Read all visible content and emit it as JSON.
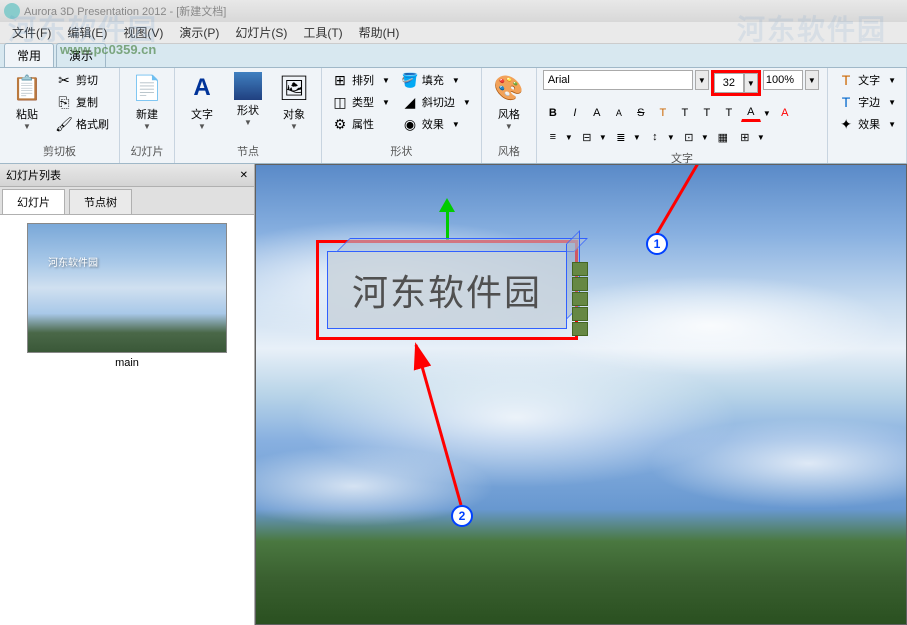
{
  "title": "Aurora 3D Presentation 2012 - [新建文档]",
  "watermark": "河东软件园",
  "watermark_url": "www.pc0359.cn",
  "menu": {
    "file": "文件(F)",
    "edit": "编辑(E)",
    "view": "视图(V)",
    "present": "演示(P)",
    "slide": "幻灯片(S)",
    "tools": "工具(T)",
    "help": "帮助(H)"
  },
  "tabs": {
    "common": "常用",
    "present": "演示"
  },
  "ribbon": {
    "clipboard": {
      "label": "剪切板",
      "paste": "粘贴",
      "cut": "剪切",
      "copy": "复制",
      "format": "格式刷"
    },
    "slide": {
      "label": "幻灯片",
      "new": "新建"
    },
    "node": {
      "label": "节点",
      "text": "文字",
      "shape": "形状",
      "object": "对象"
    },
    "shape": {
      "label": "形状",
      "arrange": "排列",
      "type": "类型",
      "attribute": "属性",
      "fill": "填充",
      "bevel": "斜切边",
      "effect": "效果"
    },
    "style": {
      "label": "风格",
      "style_btn": "风格"
    },
    "font": {
      "label": "文字",
      "name": "Arial",
      "size": "32",
      "zoom": "100%",
      "text_btn": "文字",
      "edge_btn": "字边",
      "effect_btn": "效果"
    }
  },
  "left_panel": {
    "title": "幻灯片列表",
    "tabs": {
      "slide": "幻灯片",
      "nodes": "节点树"
    },
    "thumb_text": "河东软件园",
    "slide_name": "main"
  },
  "canvas": {
    "text_3d": "河东软件园"
  },
  "annotations": {
    "marker1": "1",
    "marker2": "2"
  }
}
